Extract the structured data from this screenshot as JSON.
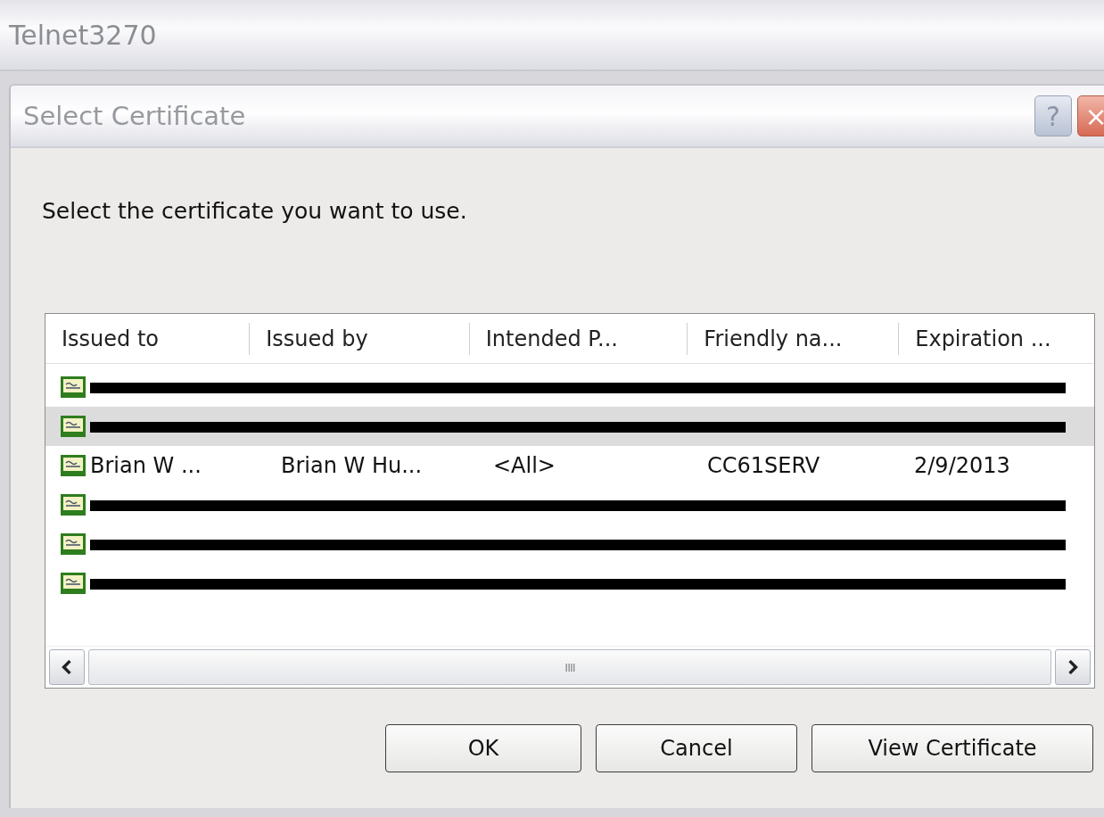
{
  "window": {
    "title": "Telnet3270"
  },
  "dialog": {
    "title": "Select Certificate",
    "help_button": "?",
    "close_button": "×"
  },
  "instruction": "Select the certificate you want to use.",
  "table": {
    "columns": [
      "Issued to",
      "Issued by",
      "Intended P...",
      "Friendly na...",
      "Expiration ..."
    ],
    "rows": [
      {
        "redacted": true,
        "selected": false
      },
      {
        "redacted": true,
        "selected": true
      },
      {
        "redacted": false,
        "selected": false,
        "cells": [
          "Brian W ...",
          "Brian W Hu...",
          "<All>",
          "CC61SERV",
          "2/9/2013"
        ]
      },
      {
        "redacted": true,
        "selected": false
      },
      {
        "redacted": true,
        "selected": false
      },
      {
        "redacted": true,
        "selected": false
      }
    ]
  },
  "scrollbar": {
    "thumb_grip": "IIII"
  },
  "buttons": [
    "OK",
    "Cancel",
    "View Certificate"
  ]
}
